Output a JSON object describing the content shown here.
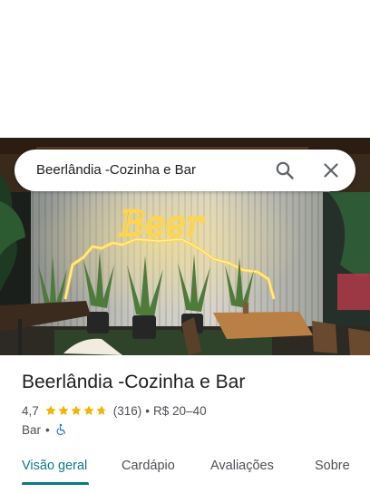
{
  "search": {
    "query": "Beerlândia -Cozinha e Bar"
  },
  "place": {
    "name": "Beerlândia -Cozinha e Bar",
    "rating": "4,7",
    "rating_value": 4.7,
    "reviews": "(316)",
    "separator": "•",
    "price": "R$ 20–40",
    "category": "Bar",
    "photo_sign_text": "Beer"
  },
  "tabs": [
    {
      "label": "Visão geral",
      "active": true
    },
    {
      "label": "Cardápio",
      "active": false
    },
    {
      "label": "Avaliações",
      "active": false
    },
    {
      "label": "Sobre",
      "active": false
    }
  ],
  "colors": {
    "accent": "#0b7a87",
    "star": "#f4b400",
    "accessibility": "#1a73e8",
    "neon": "#ffd54a"
  },
  "icons": {
    "search": "search-icon",
    "close": "close-icon",
    "star": "star-icon",
    "accessibility": "wheelchair-icon"
  }
}
